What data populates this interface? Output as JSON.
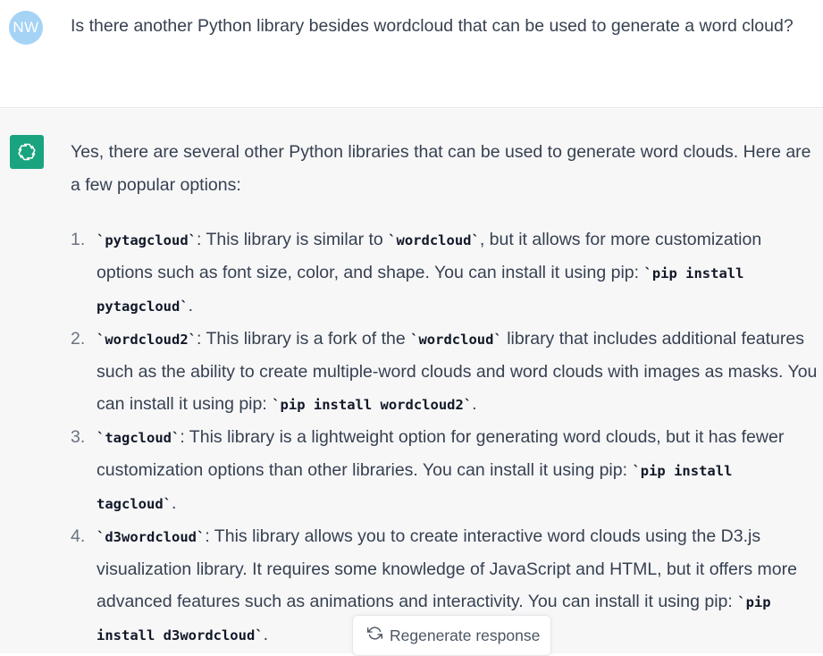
{
  "user_message": {
    "avatar_initials": "NW",
    "text": "Is there another Python library besides wordcloud that can be used to generate a word cloud?"
  },
  "assistant_message": {
    "avatar_icon": "openai-logo-icon",
    "intro": "Yes, there are several other Python libraries that can be used to generate word clouds. Here are a few popular options:",
    "items": [
      {
        "number": "1.",
        "code": "`pytagcloud`",
        "text_a": ": This library is similar to ",
        "code_b": "`wordcloud`",
        "text_b": ", but it allows for more customization options such as font size, color, and shape. You can install it using pip: ",
        "code_c": "`pip install pytagcloud`",
        "text_c": "."
      },
      {
        "number": "2.",
        "code": "`wordcloud2`",
        "text_a": ": This library is a fork of the ",
        "code_b": "`wordcloud`",
        "text_b": " library that includes additional features such as the ability to create multiple-word clouds and word clouds with images as masks. You can install it using pip: ",
        "code_c": "`pip install wordcloud2`",
        "text_c": "."
      },
      {
        "number": "3.",
        "code": "`tagcloud`",
        "text_a": ": This library is a lightweight option for generating word clouds, but it has fewer customization options than other libraries. You can install it using pip: ",
        "code_c": "`pip install tagcloud`",
        "text_c": "."
      },
      {
        "number": "4.",
        "code": "`d3wordcloud`",
        "text_a": ": This library allows you to create interactive word clouds using the D3.js visualization library. It requires some knowledge of JavaScript and HTML, but it offers more advanced features such as animations and interactivity. You can install it using pip: ",
        "code_c": "`pip install d3wordcloud`",
        "text_c": "."
      }
    ]
  },
  "regenerate_button": {
    "icon": "refresh-icon",
    "label": "Regenerate response"
  }
}
